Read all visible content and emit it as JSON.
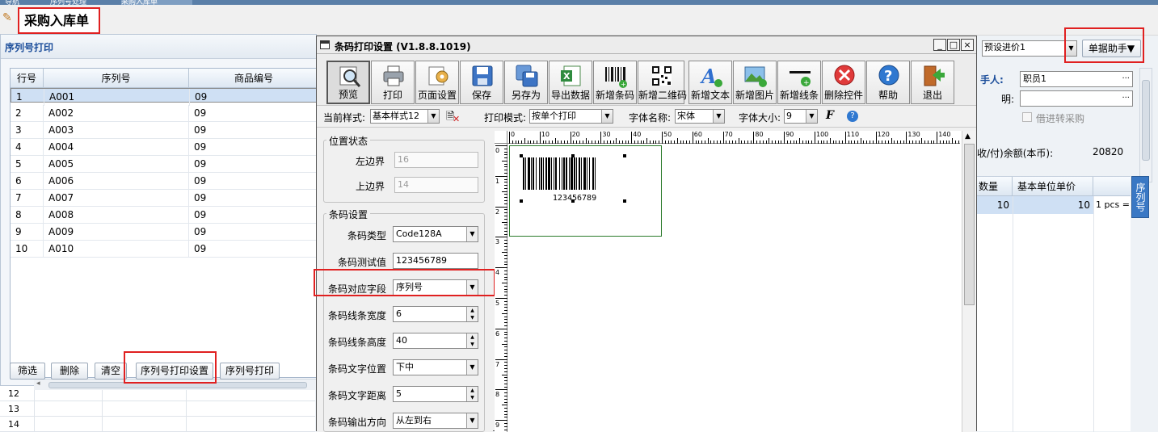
{
  "window_tabs": [
    "导航",
    "序列号处理",
    "采购入库单"
  ],
  "page": {
    "title": "采购入库单"
  },
  "serial_panel": {
    "title": "序列号打印",
    "columns": [
      "行号",
      "序列号",
      "商品编号"
    ],
    "rows": [
      {
        "no": "1",
        "serial": "A001",
        "code": "09"
      },
      {
        "no": "2",
        "serial": "A002",
        "code": "09"
      },
      {
        "no": "3",
        "serial": "A003",
        "code": "09"
      },
      {
        "no": "4",
        "serial": "A004",
        "code": "09"
      },
      {
        "no": "5",
        "serial": "A005",
        "code": "09"
      },
      {
        "no": "6",
        "serial": "A006",
        "code": "09"
      },
      {
        "no": "7",
        "serial": "A007",
        "code": "09"
      },
      {
        "no": "8",
        "serial": "A008",
        "code": "09"
      },
      {
        "no": "9",
        "serial": "A009",
        "code": "09"
      },
      {
        "no": "10",
        "serial": "A010",
        "code": "09"
      }
    ],
    "buttons": {
      "filter": "筛选",
      "delete": "删除",
      "clear": "清空",
      "print_settings": "序列号打印设置",
      "print": "序列号打印"
    }
  },
  "bg_grid": {
    "row_numbers": [
      "12",
      "13",
      "14"
    ]
  },
  "dialog": {
    "title": "条码打印设置 (V1.8.8.1019)",
    "window_buttons": [
      "_",
      "□",
      "×"
    ],
    "toolbar": [
      "预览",
      "打印",
      "页面设置",
      "保存",
      "另存为",
      "导出数据",
      "新增条码",
      "新增二维码",
      "新增文本",
      "新增图片",
      "新增线条",
      "删除控件",
      "帮助",
      "退出"
    ],
    "options": {
      "style_label": "当前样式:",
      "style_value": "基本样式12",
      "mode_label": "打印模式:",
      "mode_value": "按单个打印",
      "font_label": "字体名称:",
      "font_value": "宋体",
      "size_label": "字体大小:",
      "size_value": "9"
    },
    "position": {
      "title": "位置状态",
      "left_label": "左边界",
      "left_value": "16",
      "top_label": "上边界",
      "top_value": "14"
    },
    "barcode": {
      "title": "条码设置",
      "fields": [
        {
          "label": "条码类型",
          "value": "Code128A"
        },
        {
          "label": "条码测试值",
          "value": "123456789"
        },
        {
          "label": "条码对应字段",
          "value": "序列号"
        },
        {
          "label": "条码线条宽度",
          "value": "6"
        },
        {
          "label": "条码线条高度",
          "value": "40"
        },
        {
          "label": "条码文字位置",
          "value": "下中"
        },
        {
          "label": "条码文字距离",
          "value": "5"
        },
        {
          "label": "条码输出方向",
          "value": "从左到右"
        }
      ]
    },
    "ruler_h": [
      "0",
      "10",
      "20",
      "30",
      "40",
      "50",
      "60",
      "70",
      "80",
      "90",
      "100",
      "110",
      "120",
      "130",
      "140"
    ],
    "ruler_v": [
      "0",
      "1",
      "2",
      "3",
      "4",
      "5",
      "6",
      "7",
      "8",
      "9"
    ],
    "label_preview": {
      "barcode_text": "123456789"
    }
  },
  "right_panel": {
    "price_select": "预设进价1",
    "assistant_button": "单据助手▼",
    "handler_label": "手人:",
    "handler_value": "职员1",
    "note_label": "明:",
    "transfer_checkbox": "借进转采购",
    "balance_label": "收/付)余额(本币):",
    "balance_value": "20820",
    "grid_columns": [
      "数量",
      "基本单位单价"
    ],
    "grid_row": {
      "qty": "10",
      "price": "10",
      "unit": "1 pcs ="
    },
    "side_tab": "序列号"
  },
  "colors": {
    "highlight_red": "#e02020",
    "selected_row": "#cfe0f4",
    "panel_title": "#1b4d9a"
  }
}
